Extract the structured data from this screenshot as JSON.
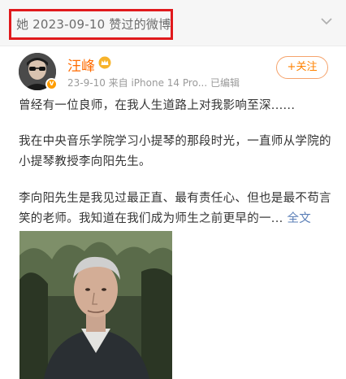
{
  "liked_header": {
    "text": "她 2023-09-10 赞过的微博"
  },
  "post": {
    "username": "汪峰",
    "meta": "23-9-10  来自 iPhone 14 Pro...  已编辑",
    "follow_label": "+关注",
    "paragraph1": "曾经有一位良师，在我人生道路上对我影响至深......",
    "paragraph2": "我在中央音乐学院学习小提琴的那段时光，一直师从学院的小提琴教授李向阳先生。",
    "paragraph3": "李向阳先生是我见过最正直、最有责任心、但也是最不苟言笑的老师。我知道在我们成为师生之前更早的一...",
    "full_text_link": "全文"
  },
  "colors": {
    "accent": "#ff8200",
    "username": "#ff6b00",
    "highlight": "#e0191c",
    "link": "#5b7fb7"
  },
  "icons": {
    "chevron": "chevron-down-icon",
    "crown": "member-crown-icon",
    "verified": "verified-v-icon"
  }
}
